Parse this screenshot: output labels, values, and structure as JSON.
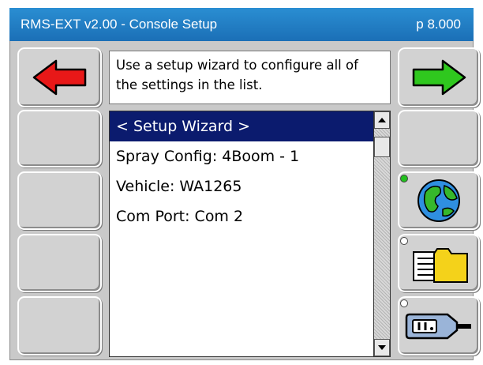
{
  "window": {
    "title": "RMS-EXT v2.00 - Console Setup",
    "page_label": "p 8.000"
  },
  "description": "Use a setup wizard to configure all of the settings in the list.",
  "list": {
    "items": [
      {
        "label": "< Setup Wizard >",
        "selected": true
      },
      {
        "label": "Spray Config: 4Boom - 1",
        "selected": false
      },
      {
        "label": "Vehicle: WA1265",
        "selected": false
      },
      {
        "label": "Com Port: Com 2",
        "selected": false
      }
    ]
  },
  "nav": {
    "back_icon": "red-left-arrow-icon",
    "forward_icon": "green-right-arrow-icon"
  },
  "side_buttons": {
    "globe": {
      "icon": "globe-icon",
      "indicator_color": "#22c01e"
    },
    "folder": {
      "icon": "folder-documents-icon",
      "indicator_color": "#ffffff"
    },
    "serial": {
      "icon": "serial-connector-icon",
      "indicator_color": "#ffffff"
    }
  },
  "colors": {
    "title_bar": "#1e78c2",
    "selection": "#0b1b6e",
    "back_arrow": "#e81818",
    "forward_arrow": "#2fc81e"
  }
}
